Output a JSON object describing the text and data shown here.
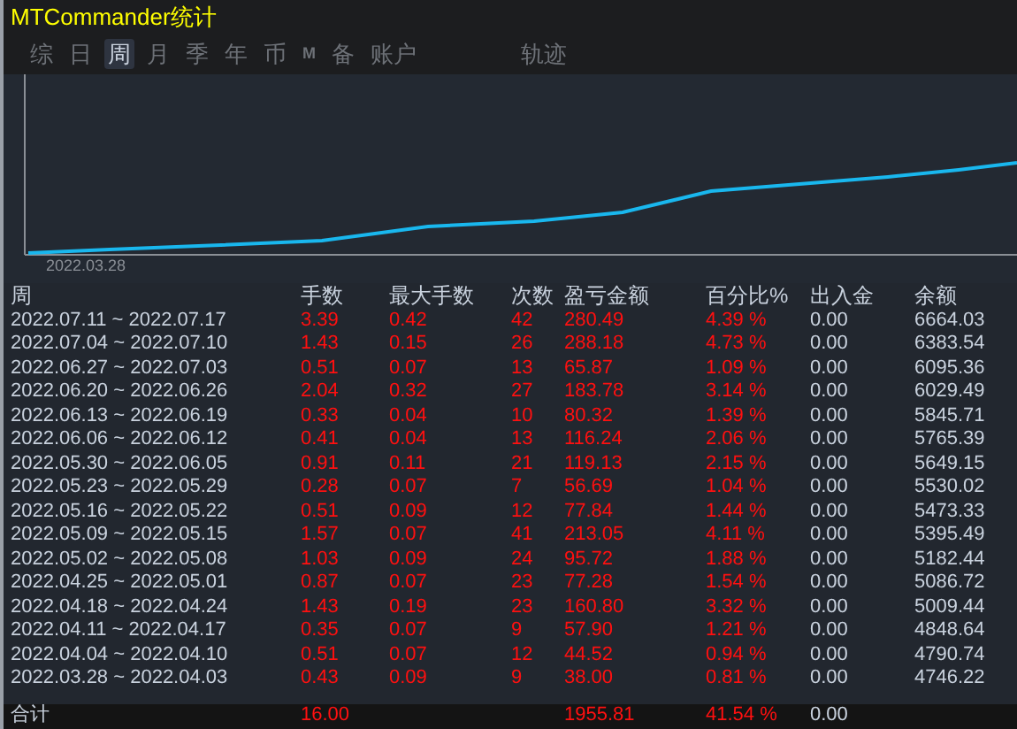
{
  "window": {
    "title": "MTCommander统计"
  },
  "tabs": [
    {
      "label": "综",
      "selected": false,
      "kind": "text"
    },
    {
      "label": "日",
      "selected": false,
      "kind": "text"
    },
    {
      "label": "周",
      "selected": true,
      "kind": "text"
    },
    {
      "label": "月",
      "selected": false,
      "kind": "text"
    },
    {
      "label": "季",
      "selected": false,
      "kind": "text"
    },
    {
      "label": "年",
      "selected": false,
      "kind": "text"
    },
    {
      "label": "币",
      "selected": false,
      "kind": "text"
    },
    {
      "label": "M",
      "selected": false,
      "kind": "mark"
    },
    {
      "label": "备",
      "selected": false,
      "kind": "text"
    },
    {
      "label": "账户",
      "selected": false,
      "kind": "text"
    },
    {
      "label": "轨迹",
      "selected": false,
      "kind": "far"
    }
  ],
  "chart": {
    "start_label": "2022.03.28"
  },
  "table": {
    "columns": [
      "周",
      "手数",
      "最大手数",
      "次数",
      "盈亏金额",
      "百分比%",
      "出入金",
      "余额"
    ],
    "rows": [
      [
        "2022.07.11 ~ 2022.07.17",
        "3.39",
        "0.42",
        "42",
        "280.49",
        "4.39 %",
        "0.00",
        "6664.03"
      ],
      [
        "2022.07.04 ~ 2022.07.10",
        "1.43",
        "0.15",
        "26",
        "288.18",
        "4.73 %",
        "0.00",
        "6383.54"
      ],
      [
        "2022.06.27 ~ 2022.07.03",
        "0.51",
        "0.07",
        "13",
        "65.87",
        "1.09 %",
        "0.00",
        "6095.36"
      ],
      [
        "2022.06.20 ~ 2022.06.26",
        "2.04",
        "0.32",
        "27",
        "183.78",
        "3.14 %",
        "0.00",
        "6029.49"
      ],
      [
        "2022.06.13 ~ 2022.06.19",
        "0.33",
        "0.04",
        "10",
        "80.32",
        "1.39 %",
        "0.00",
        "5845.71"
      ],
      [
        "2022.06.06 ~ 2022.06.12",
        "0.41",
        "0.04",
        "13",
        "116.24",
        "2.06 %",
        "0.00",
        "5765.39"
      ],
      [
        "2022.05.30 ~ 2022.06.05",
        "0.91",
        "0.11",
        "21",
        "119.13",
        "2.15 %",
        "0.00",
        "5649.15"
      ],
      [
        "2022.05.23 ~ 2022.05.29",
        "0.28",
        "0.07",
        "7",
        "56.69",
        "1.04 %",
        "0.00",
        "5530.02"
      ],
      [
        "2022.05.16 ~ 2022.05.22",
        "0.51",
        "0.09",
        "12",
        "77.84",
        "1.44 %",
        "0.00",
        "5473.33"
      ],
      [
        "2022.05.09 ~ 2022.05.15",
        "1.57",
        "0.07",
        "41",
        "213.05",
        "4.11 %",
        "0.00",
        "5395.49"
      ],
      [
        "2022.05.02 ~ 2022.05.08",
        "1.03",
        "0.09",
        "24",
        "95.72",
        "1.88 %",
        "0.00",
        "5182.44"
      ],
      [
        "2022.04.25 ~ 2022.05.01",
        "0.87",
        "0.07",
        "23",
        "77.28",
        "1.54 %",
        "0.00",
        "5086.72"
      ],
      [
        "2022.04.18 ~ 2022.04.24",
        "1.43",
        "0.19",
        "23",
        "160.80",
        "3.32 %",
        "0.00",
        "5009.44"
      ],
      [
        "2022.04.11 ~ 2022.04.17",
        "0.35",
        "0.07",
        "9",
        "57.90",
        "1.21 %",
        "0.00",
        "4848.64"
      ],
      [
        "2022.04.04 ~ 2022.04.10",
        "0.51",
        "0.07",
        "12",
        "44.52",
        "0.94 %",
        "0.00",
        "4790.74"
      ],
      [
        "2022.03.28 ~ 2022.04.03",
        "0.43",
        "0.09",
        "9",
        "38.00",
        "0.81 %",
        "0.00",
        "4746.22"
      ]
    ],
    "total": {
      "label": "合计",
      "lots": "16.00",
      "profit": "1955.81",
      "percent": "41.54 %",
      "deposit": "0.00"
    }
  }
}
